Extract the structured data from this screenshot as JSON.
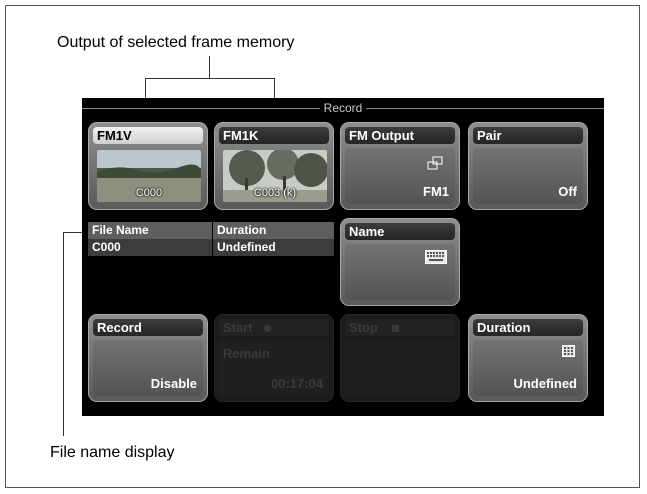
{
  "callouts": {
    "top": "Output of selected frame memory",
    "bottom": "File name display"
  },
  "panel": {
    "title": "Record"
  },
  "buttons": {
    "fm1v": {
      "label": "FM1V",
      "thumb_text": "C000"
    },
    "fm1k": {
      "label": "FM1K",
      "thumb_text": "C003 (k)"
    },
    "fm_output": {
      "label": "FM Output",
      "value": "FM1",
      "icon": "frame-output-icon"
    },
    "pair": {
      "label": "Pair",
      "value": "Off"
    },
    "name": {
      "label": "Name",
      "icon": "keyboard-icon"
    },
    "record": {
      "label": "Record",
      "value": "Disable"
    },
    "start": {
      "label": "Start",
      "sub_label": "Remain",
      "value": "00:17:04",
      "icon": "record-dot-icon"
    },
    "stop": {
      "label": "Stop",
      "icon": "stop-square-icon"
    },
    "duration": {
      "label": "Duration",
      "value": "Undefined",
      "icon": "numeric-keypad-icon"
    }
  },
  "file_table": {
    "columns": [
      "File Name",
      "Duration"
    ],
    "rows": [
      [
        "C000",
        "Undefined"
      ]
    ]
  },
  "colors": {
    "panel_bg": "#000000",
    "button_face": "#7a7a7a",
    "tab_selected": "#e6e6e6",
    "disabled_face": "#1c1c1c"
  }
}
